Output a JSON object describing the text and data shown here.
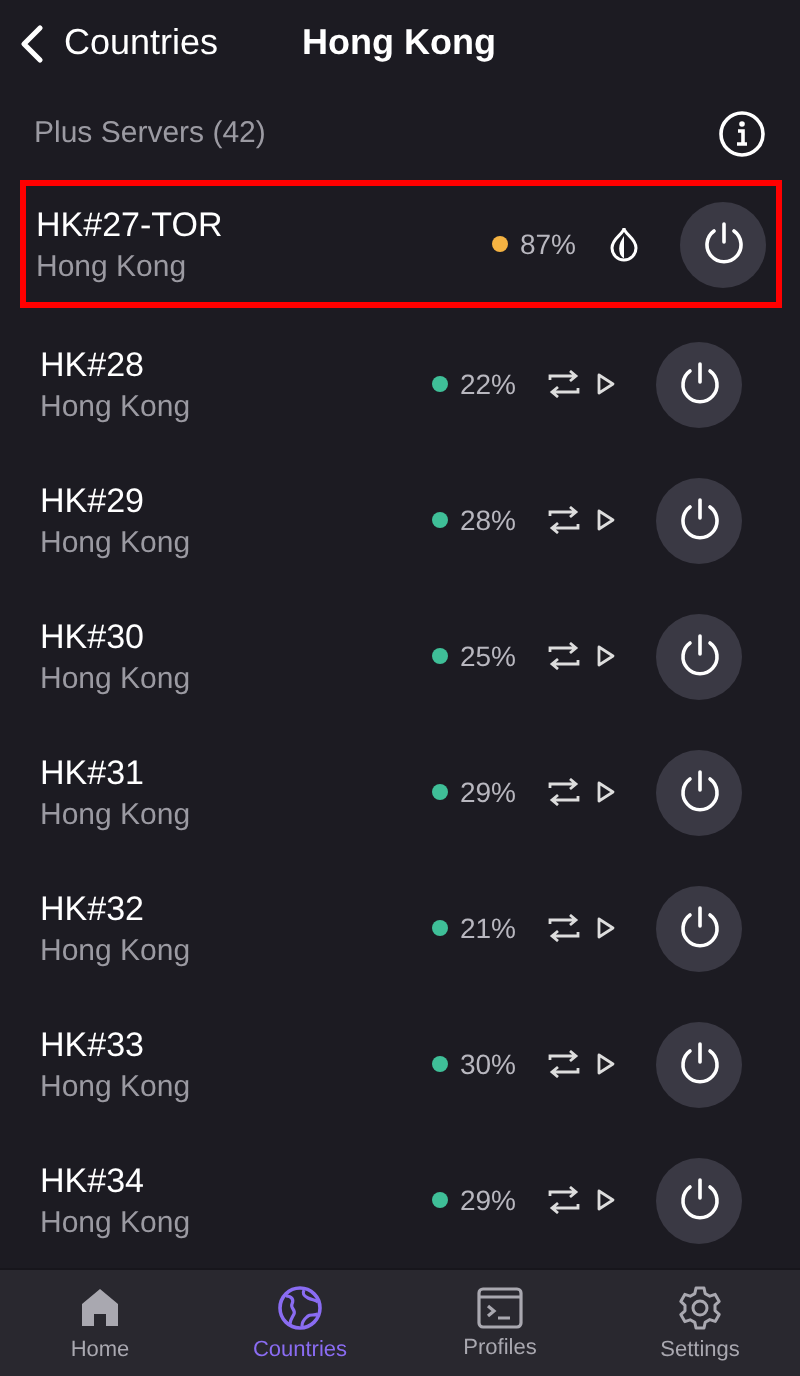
{
  "nav": {
    "back_label": "Countries",
    "title": "Hong Kong"
  },
  "section": {
    "title": "Plus Servers (42)"
  },
  "servers": [
    {
      "name": "HK#27-TOR",
      "location": "Hong Kong",
      "load": "87%",
      "color": "#f5b342",
      "kind": "tor",
      "highlighted": true
    },
    {
      "name": "HK#28",
      "location": "Hong Kong",
      "load": "22%",
      "color": "#3fbf98",
      "kind": "p2p",
      "highlighted": false
    },
    {
      "name": "HK#29",
      "location": "Hong Kong",
      "load": "28%",
      "color": "#3fbf98",
      "kind": "p2p",
      "highlighted": false
    },
    {
      "name": "HK#30",
      "location": "Hong Kong",
      "load": "25%",
      "color": "#3fbf98",
      "kind": "p2p",
      "highlighted": false
    },
    {
      "name": "HK#31",
      "location": "Hong Kong",
      "load": "29%",
      "color": "#3fbf98",
      "kind": "p2p",
      "highlighted": false
    },
    {
      "name": "HK#32",
      "location": "Hong Kong",
      "load": "21%",
      "color": "#3fbf98",
      "kind": "p2p",
      "highlighted": false
    },
    {
      "name": "HK#33",
      "location": "Hong Kong",
      "load": "30%",
      "color": "#3fbf98",
      "kind": "p2p",
      "highlighted": false
    },
    {
      "name": "HK#34",
      "location": "Hong Kong",
      "load": "29%",
      "color": "#3fbf98",
      "kind": "p2p",
      "highlighted": false
    }
  ],
  "tabs": [
    {
      "label": "Home",
      "kind": "home",
      "selected": false
    },
    {
      "label": "Countries",
      "kind": "countries",
      "selected": true
    },
    {
      "label": "Profiles",
      "kind": "profiles",
      "selected": false
    },
    {
      "label": "Settings",
      "kind": "settings",
      "selected": false
    }
  ]
}
